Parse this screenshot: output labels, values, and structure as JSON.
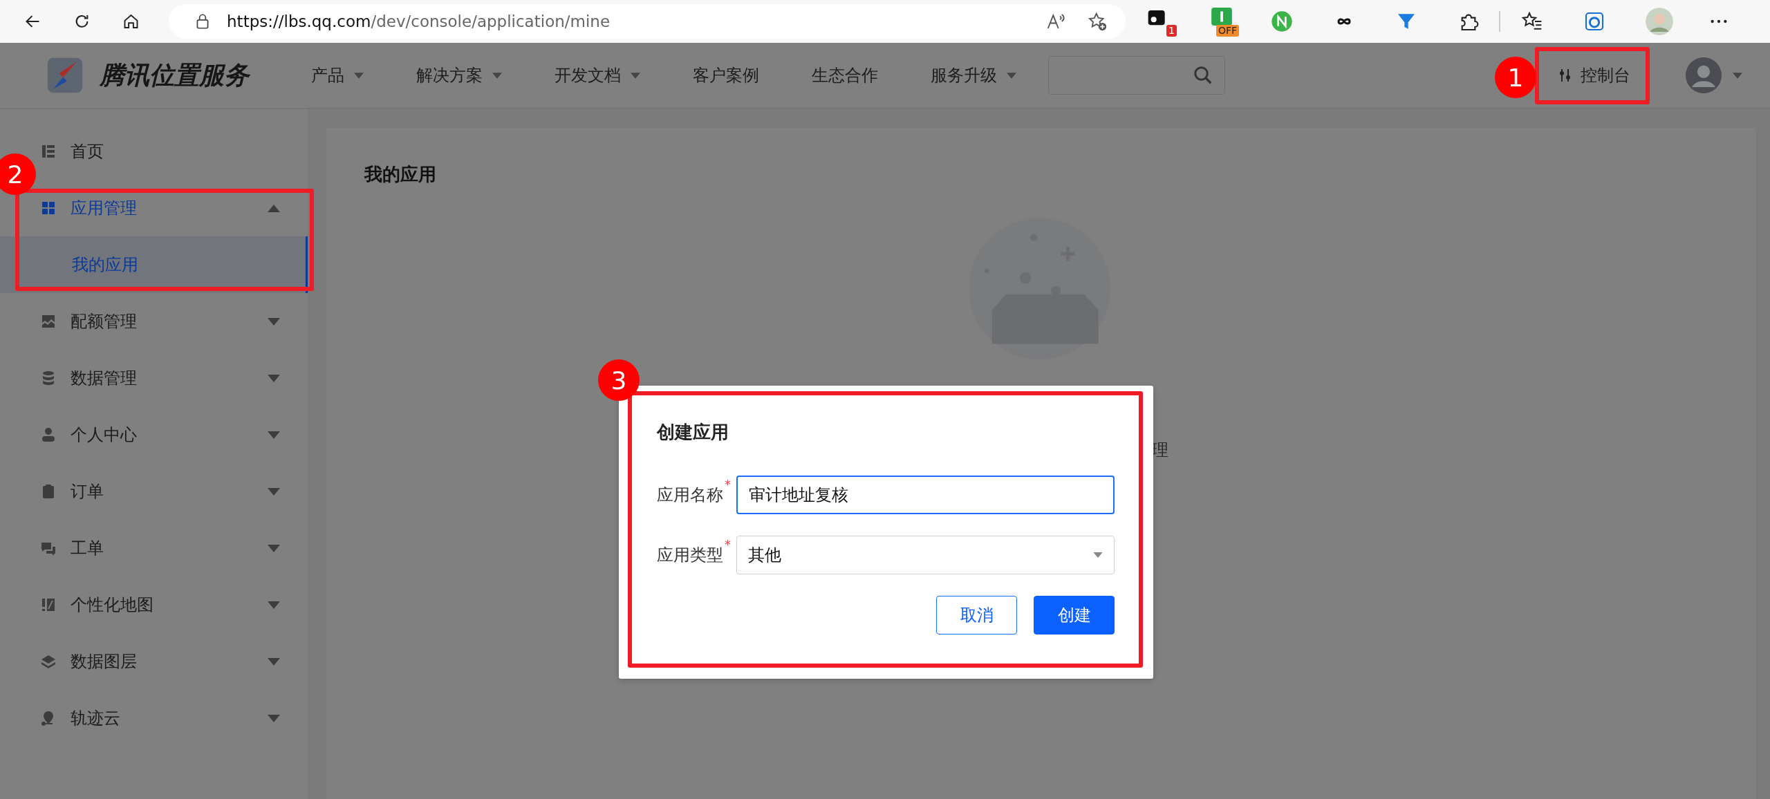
{
  "browser": {
    "url_host": "https://lbs.qq.com",
    "url_path": "/dev/console/application/mine",
    "extensions": [
      {
        "kind": "badge-ext",
        "badge": "1"
      },
      {
        "kind": "off-ext",
        "badge": "OFF"
      },
      {
        "kind": "n-ext"
      },
      {
        "kind": "infinity-ext"
      },
      {
        "kind": "funnel-ext"
      },
      {
        "kind": "puzzle-ext"
      }
    ]
  },
  "header": {
    "logo_text": "腾讯位置服务",
    "nav": [
      {
        "label": "产品",
        "dropdown": true
      },
      {
        "label": "解决方案",
        "dropdown": true
      },
      {
        "label": "开发文档",
        "dropdown": true
      },
      {
        "label": "客户案例",
        "dropdown": false
      },
      {
        "label": "生态合作",
        "dropdown": false
      },
      {
        "label": "服务升级",
        "dropdown": true
      }
    ],
    "console_label": "控制台"
  },
  "sidebar": {
    "items": [
      {
        "kind": "home",
        "label": "首页",
        "has_children": false,
        "selected": false
      },
      {
        "kind": "grid",
        "label": "应用管理",
        "expanded": true,
        "has_children": true,
        "selected": true,
        "children": [
          {
            "label": "我的应用",
            "selected": true
          }
        ]
      },
      {
        "kind": "chart",
        "label": "配额管理",
        "expanded": false,
        "has_children": true,
        "selected": false
      },
      {
        "kind": "database",
        "label": "数据管理",
        "expanded": false,
        "has_children": true,
        "selected": false
      },
      {
        "kind": "person",
        "label": "个人中心",
        "expanded": false,
        "has_children": true,
        "selected": false
      },
      {
        "kind": "clipboard",
        "label": "订单",
        "expanded": false,
        "has_children": true,
        "selected": false
      },
      {
        "kind": "chat",
        "label": "工单",
        "expanded": false,
        "has_children": true,
        "selected": false
      },
      {
        "kind": "style",
        "label": "个性化地图",
        "expanded": false,
        "has_children": true,
        "selected": false
      },
      {
        "kind": "layers",
        "label": "数据图层",
        "expanded": false,
        "has_children": true,
        "selected": false
      },
      {
        "kind": "pin",
        "label": "轨迹云",
        "expanded": false,
        "has_children": true,
        "selected": false
      }
    ]
  },
  "content": {
    "title": "我的应用",
    "hidden_text_fragment": "理"
  },
  "dialog": {
    "title": "创建应用",
    "fields": [
      {
        "kind": "input",
        "label": "应用名称",
        "required_mark": "*",
        "value": "审计地址复核",
        "focused": true
      },
      {
        "kind": "select",
        "label": "应用类型",
        "required_mark": "*",
        "value": "其他",
        "focused": false
      }
    ],
    "buttons": [
      {
        "kind": "secondary",
        "label": "取消"
      },
      {
        "kind": "primary",
        "label": "创建"
      }
    ]
  },
  "annotations": [
    {
      "number": "1"
    },
    {
      "number": "2"
    },
    {
      "number": "3"
    }
  ]
}
